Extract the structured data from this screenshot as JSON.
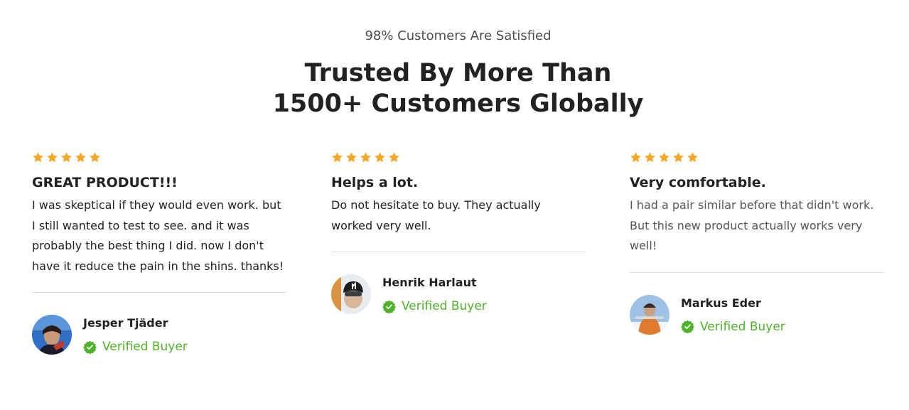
{
  "header": {
    "eyebrow": "98% Customers Are Satisfied",
    "headline_line1": "Trusted By More Than",
    "headline_line2": "1500+ Customers Globally"
  },
  "colors": {
    "star": "#f5a623",
    "verified": "#4fb32a"
  },
  "reviews": [
    {
      "rating": 5,
      "title": "GREAT PRODUCT!!!",
      "body": "I was skeptical if they would even work. but I still wanted to test to see. and it was probably the best thing I did. now I don't have it reduce the pain in the shins. thanks!",
      "author": "Jesper Tjäder",
      "badge": "Verified Buyer"
    },
    {
      "rating": 5,
      "title": "Helps a lot.",
      "body": "Do not hesitate to buy. They actually worked very well.",
      "author": "Henrik Harlaut",
      "badge": "Verified Buyer"
    },
    {
      "rating": 5,
      "title": "Very comfortable.",
      "body": "I had a pair similar before that didn't work. But this new product actually works very well!",
      "author": "Markus Eder",
      "badge": "Verified Buyer"
    }
  ]
}
